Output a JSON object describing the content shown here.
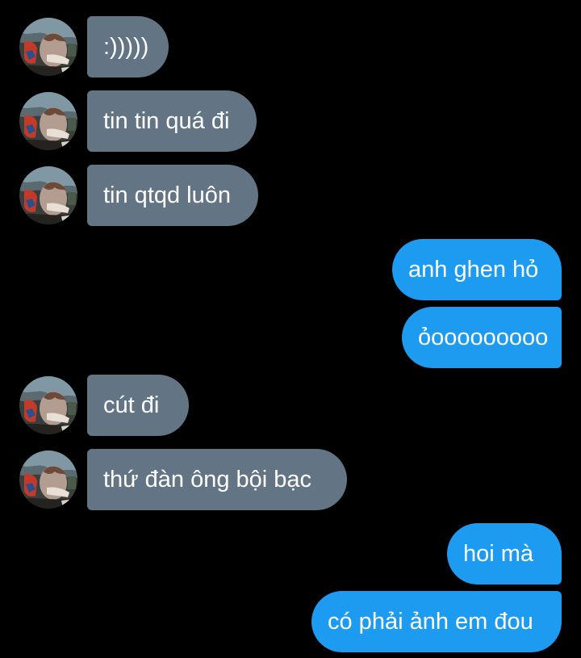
{
  "colors": {
    "background": "#000000",
    "incoming_bubble": "#637584",
    "outgoing_bubble": "#1d9bf0",
    "text": "#ffffff"
  },
  "avatar_icon": "profile-picture-icon",
  "messages": [
    {
      "from": "them",
      "text": ":)))))"
    },
    {
      "from": "them",
      "text": "tin tin quá đi"
    },
    {
      "from": "them",
      "text": "tin qtqd luôn"
    },
    {
      "from": "me",
      "text": "anh ghen hỏ"
    },
    {
      "from": "me",
      "text": "ỏooooooooo"
    },
    {
      "from": "them",
      "text": "cút đi"
    },
    {
      "from": "them",
      "text": "thứ đàn ông bội bạc"
    },
    {
      "from": "me",
      "text": "hoi mà"
    },
    {
      "from": "me",
      "text": "có phải ảnh em đou"
    }
  ]
}
